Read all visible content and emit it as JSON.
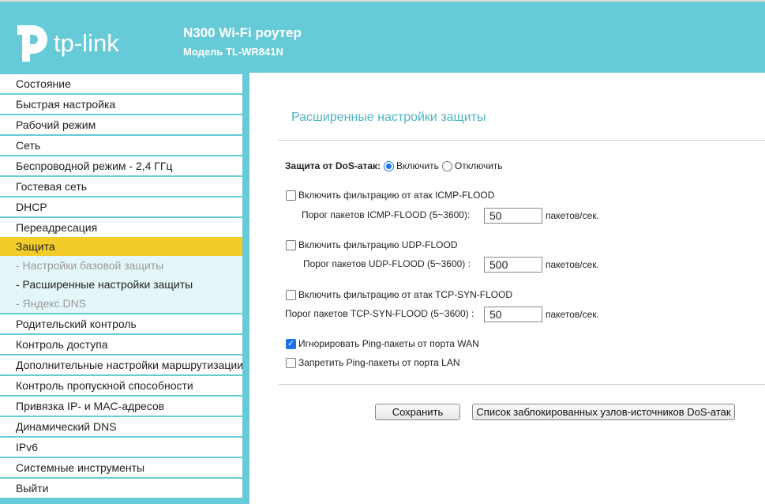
{
  "header": {
    "logo": "tp-link",
    "title": "N300 Wi-Fi роутер",
    "model": "Модель TL-WR841N"
  },
  "sidebar": {
    "items_top": [
      "Состояние",
      "Быстрая настройка",
      "Рабочий режим",
      "Сеть",
      "Беспроводной режим - 2,4 ГГц",
      "Гостевая сеть",
      "DHCP",
      "Переадресация"
    ],
    "active": "Защита",
    "sub": [
      "- Настройки базовой защиты",
      "- Расширенные настройки защиты",
      "- Яндекс.DNS"
    ],
    "items_bottom": [
      "Родительский контроль",
      "Контроль доступа",
      "Дополнительные настройки маршрутизации",
      "Контроль пропускной способности",
      "Привязка IP- и MAC-адресов",
      "Динамический DNS",
      "IPv6",
      "Системные инструменты",
      "Выйти"
    ]
  },
  "main": {
    "title": "Расширенные настройки защиты",
    "dos_label": "Защита от DoS-атак:",
    "dos_on": "Включить",
    "dos_off": "Отключить",
    "dos_selected": "Включить",
    "icmp_check": "Включить фильтрацию от атак ICMP-FLOOD",
    "icmp_label": "Порог пакетов ICMP-FLOOD (5~3600):",
    "icmp_value": "50",
    "udp_check": "Включить фильтрацию UDP-FLOOD",
    "udp_label": "Порог пакетов UDP-FLOOD (5~3600) :",
    "udp_value": "500",
    "tcp_check": "Включить фильтрацию от атак TCP-SYN-FLOOD",
    "tcp_label": "Порог пакетов TCP-SYN-FLOOD (5~3600) :",
    "tcp_value": "50",
    "unit": "пакетов/сек.",
    "wan_ping": "Игнорировать Ping-пакеты от порта WAN",
    "wan_ping_checked": true,
    "lan_ping": "Запретить Ping-пакеты от порта LAN",
    "lan_ping_checked": false,
    "save": "Сохранить",
    "blocked_list": "Список заблокированных узлов-источников DoS-атак"
  },
  "colors": {
    "header": "#67cbd7",
    "active": "#f2cd2a",
    "accent": "#4fb4c4"
  }
}
